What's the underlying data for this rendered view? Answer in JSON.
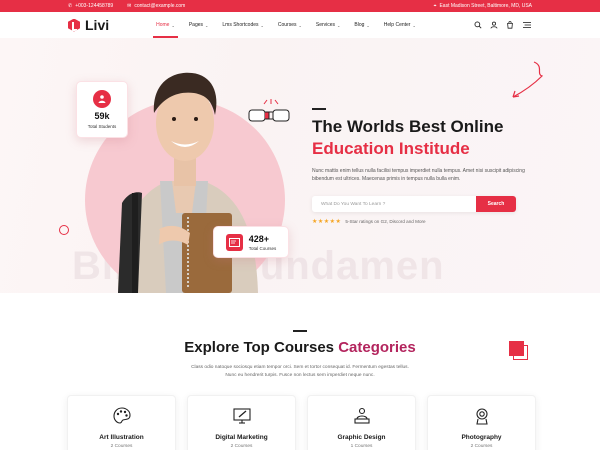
{
  "topbar": {
    "phone": "+003-124458789",
    "email": "contact@example.com",
    "address": "East Madison Street, Baltimore, MD, USA"
  },
  "nav": {
    "logo": "Livi",
    "items": [
      {
        "label": "Home",
        "active": true
      },
      {
        "label": "Pages"
      },
      {
        "label": "Lms Shortcodes"
      },
      {
        "label": "Courses"
      },
      {
        "label": "Services"
      },
      {
        "label": "Blog"
      },
      {
        "label": "Help Center"
      }
    ],
    "icons": [
      "search-icon",
      "user-icon",
      "cart-icon",
      "menu-icon"
    ]
  },
  "hero": {
    "stat_students": {
      "value": "59k",
      "label": "Total Students"
    },
    "stat_courses": {
      "value": "428+",
      "label": "Total Courses"
    },
    "title_line1": "The Worlds Best Online",
    "title_line2": "Education Institude",
    "description": "Nunc mattis enim tellus nulla facilisi tempus imperdiet nulla tempus. Amet nisi suscipit adipiscing bibendum est ultrices. Maecenas primis in tempus nulla bulla enim.",
    "search_placeholder": "What Do You Want To Learn ?",
    "search_button": "Search",
    "rating_stars": "★★★★★",
    "rating_text": "5-Star ratings on G2, Discord and More",
    "watermark": "Biblical Fundamen"
  },
  "categories": {
    "title_plain": "Explore Top Courses",
    "title_highlight": "Categories",
    "description": "Class odio natoque sociosqu etiam tempor orci. Sem et tortor consequat id. Fermentum egestas tellus. Nunc eu hendrerit turpis. Fusce non lectus sem imperdiet neque nunc.",
    "cards": [
      {
        "name": "Art Illustration",
        "count": "2 Courses",
        "icon": "palette-icon"
      },
      {
        "name": "Digital Marketing",
        "count": "2 Courses",
        "icon": "monitor-pen-icon"
      },
      {
        "name": "Graphic Design",
        "count": "1 Courses",
        "icon": "designer-icon"
      },
      {
        "name": "Photography",
        "count": "2 Courses",
        "icon": "camera-icon"
      }
    ]
  },
  "colors": {
    "accent": "#e62f45",
    "accent_dark": "#b3245d"
  }
}
